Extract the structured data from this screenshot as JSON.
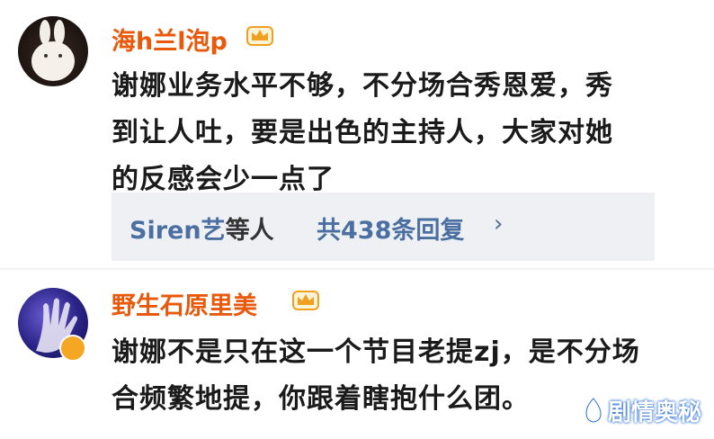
{
  "comments": [
    {
      "username": "海h兰l泡p",
      "text": "谢娜业务水平不够，不分场合秀恩爱，秀到让人吐，要是出色的主持人，大家对她的反感会少一点了",
      "replies": {
        "users": "Siren艺",
        "users_suffix": "等人",
        "count": "共438条回复",
        "chevron": "›"
      }
    },
    {
      "username": "野生石原里美",
      "text": "谢娜不是只在这一个节目老提zj，是不分场合频繁地提，你跟着瞎抱什么团。"
    }
  ],
  "watermark": "剧情奥秘",
  "colors": {
    "username": "#e8590c",
    "link": "#4a6fa0",
    "reply_bg": "#eef0f3",
    "crown": "#f0a020"
  }
}
